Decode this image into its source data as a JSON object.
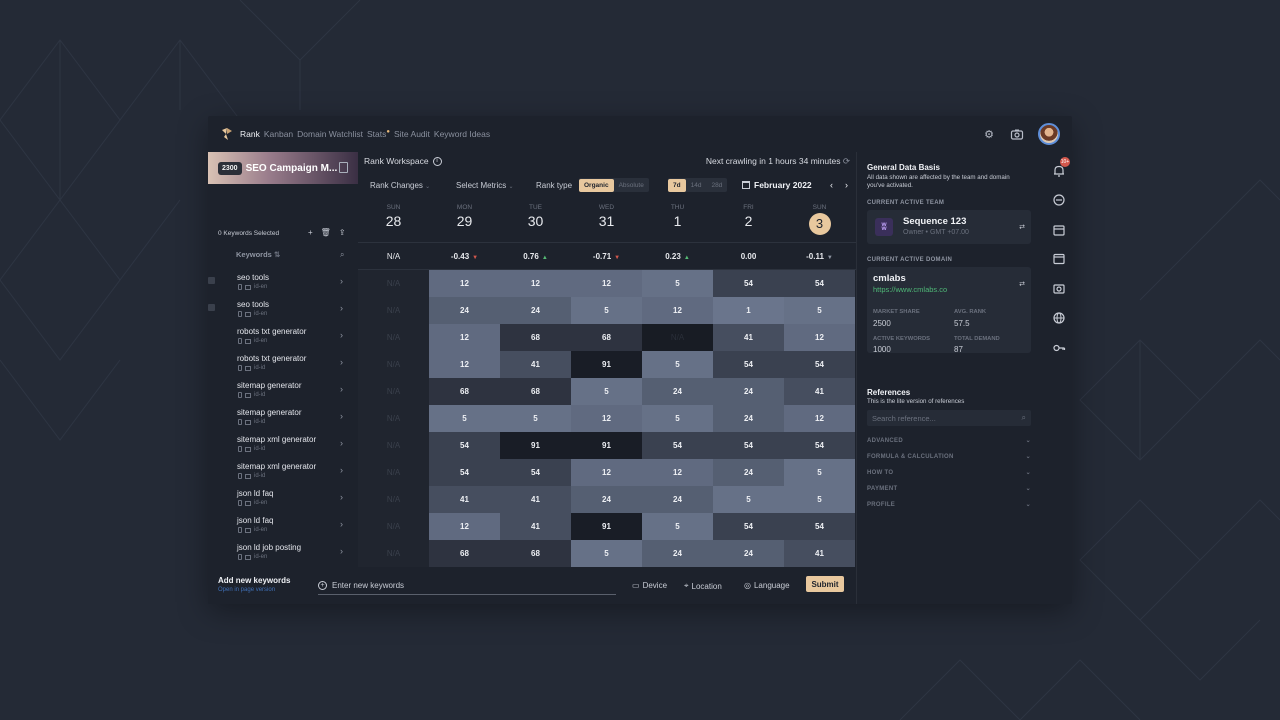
{
  "nav": {
    "items": [
      "Rank",
      "Kanban",
      "Domain Watchlist",
      "Stats",
      "Site Audit",
      "Keyword Ideas"
    ],
    "active": "Rank"
  },
  "campaign": {
    "badge": "2300",
    "name": "SEO Campaign M..."
  },
  "keywords": {
    "selected_label": "0 Keywords Selected",
    "column_header": "Keywords",
    "list": [
      {
        "name": "seo tools",
        "locale": "id-en"
      },
      {
        "name": "seo tools",
        "locale": "id-en"
      },
      {
        "name": "robots txt generator",
        "locale": "id-en"
      },
      {
        "name": "robots txt generator",
        "locale": "id-id"
      },
      {
        "name": "sitemap generator",
        "locale": "id-id"
      },
      {
        "name": "sitemap generator",
        "locale": "id-id"
      },
      {
        "name": "sitemap xml generator",
        "locale": "id-id"
      },
      {
        "name": "sitemap xml generator",
        "locale": "id-id"
      },
      {
        "name": "json ld faq",
        "locale": "id-en"
      },
      {
        "name": "json ld faq",
        "locale": "id-en"
      },
      {
        "name": "json ld job posting",
        "locale": "id-en"
      }
    ],
    "add_title": "Add new keywords",
    "add_sub": "Open in page version"
  },
  "workspace": {
    "title": "Rank Workspace",
    "crawl_status": "Next crawling in 1 hours 34 minutes",
    "rank_changes": "Rank Changes",
    "select_metrics": "Select Metrics",
    "rank_type_label": "Rank type",
    "rank_types": [
      "Organic",
      "Absolute"
    ],
    "periods": [
      "7d",
      "14d",
      "28d"
    ],
    "month": "February 2022"
  },
  "days": [
    {
      "name": "SUN",
      "num": "28"
    },
    {
      "name": "MON",
      "num": "29"
    },
    {
      "name": "TUE",
      "num": "30"
    },
    {
      "name": "WED",
      "num": "31"
    },
    {
      "name": "THU",
      "num": "1"
    },
    {
      "name": "FRI",
      "num": "2"
    },
    {
      "name": "SUN",
      "num": "3"
    }
  ],
  "changes": [
    {
      "v": "N/A",
      "dir": "none"
    },
    {
      "v": "-0.43",
      "dir": "down"
    },
    {
      "v": "0.76",
      "dir": "up"
    },
    {
      "v": "-0.71",
      "dir": "down"
    },
    {
      "v": "0.23",
      "dir": "up"
    },
    {
      "v": "0.00",
      "dir": "none"
    },
    {
      "v": "-0.11",
      "dir": "flat"
    }
  ],
  "ranks": [
    [
      "N/A",
      "12",
      "12",
      "12",
      "5",
      "54",
      "54"
    ],
    [
      "N/A",
      "24",
      "24",
      "5",
      "12",
      "1",
      "5"
    ],
    [
      "N/A",
      "12",
      "68",
      "68",
      "N/A",
      "41",
      "12"
    ],
    [
      "N/A",
      "12",
      "41",
      "91",
      "5",
      "54",
      "54"
    ],
    [
      "N/A",
      "68",
      "68",
      "5",
      "24",
      "24",
      "41"
    ],
    [
      "N/A",
      "5",
      "5",
      "12",
      "5",
      "24",
      "12"
    ],
    [
      "N/A",
      "54",
      "91",
      "91",
      "54",
      "54",
      "54"
    ],
    [
      "N/A",
      "54",
      "54",
      "12",
      "12",
      "24",
      "5"
    ],
    [
      "N/A",
      "41",
      "41",
      "24",
      "24",
      "5",
      "5"
    ],
    [
      "N/A",
      "12",
      "41",
      "91",
      "5",
      "54",
      "54"
    ],
    [
      "N/A",
      "68",
      "68",
      "5",
      "24",
      "24",
      "41"
    ]
  ],
  "input": {
    "placeholder": "Enter new keywords",
    "device": "Device",
    "location": "Location",
    "language": "Language",
    "submit": "Submit"
  },
  "right": {
    "title": "General Data Basis",
    "desc": "All data shown are affected by the team and domain you've activated.",
    "team_section": "CURRENT ACTIVE TEAM",
    "team_name": "Sequence 123",
    "team_sub": "Owner • GMT +07.00",
    "domain_section": "CURRENT ACTIVE DOMAIN",
    "domain_name": "cmlabs",
    "domain_url": "https://www.cmlabs.co",
    "stats": [
      {
        "label": "MARKET SHARE",
        "value": "2500"
      },
      {
        "label": "AVG. RANK",
        "value": "57.5"
      },
      {
        "label": "ACTIVE KEYWORDS",
        "value": "1000"
      },
      {
        "label": "TOTAL DEMAND",
        "value": "87"
      }
    ],
    "ref_title": "References",
    "ref_sub": "This is the lite version of references",
    "ref_placeholder": "Search reference...",
    "accordions": [
      "ADVANCED",
      "FORMULA & CALCULATION",
      "HOW TO",
      "PAYMENT",
      "PROFILE"
    ],
    "bell_badge": "10+"
  }
}
